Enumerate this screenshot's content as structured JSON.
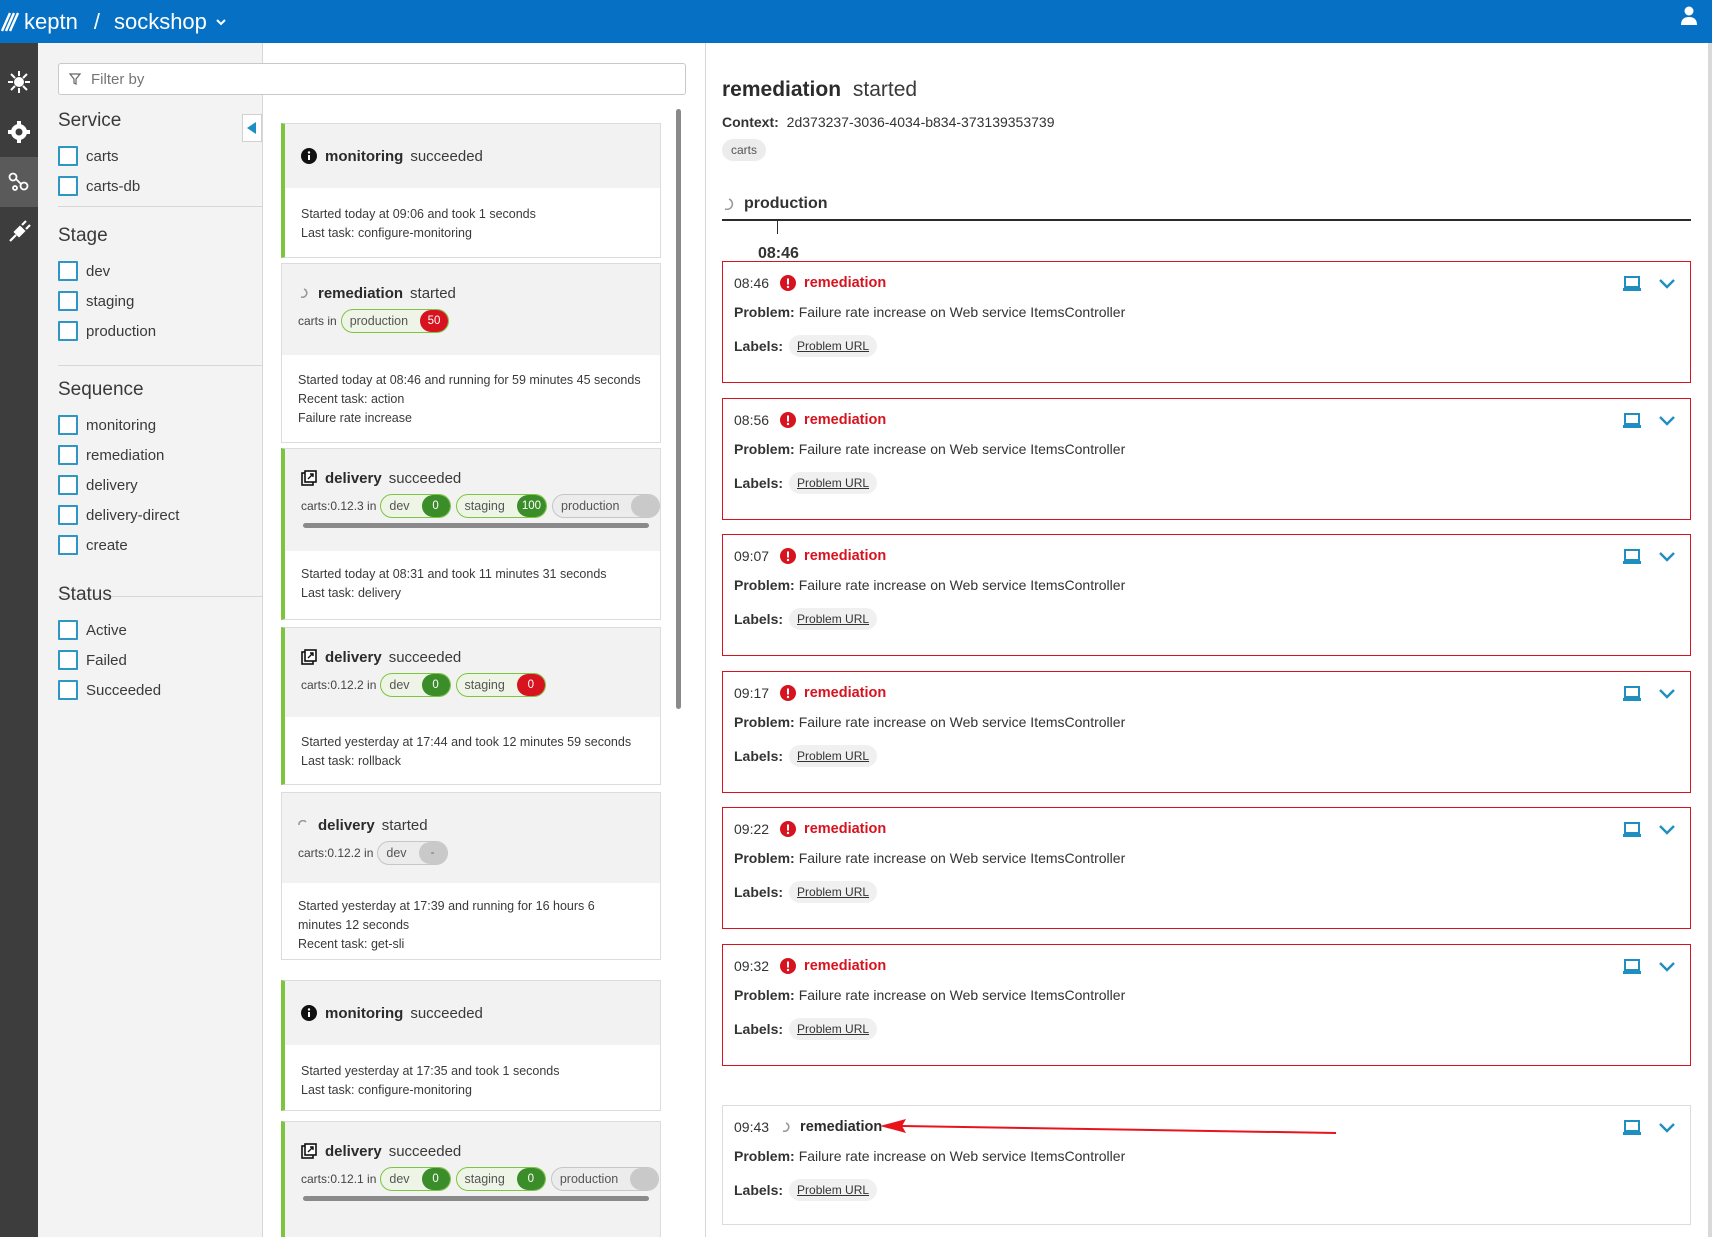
{
  "topbar": {
    "brand": "keptn",
    "separator": "/",
    "project": "sockshop"
  },
  "rail": {
    "items": [
      "environment-icon",
      "settings-icon",
      "sequences-icon",
      "integrations-icon"
    ]
  },
  "filter": {
    "placeholder": "Filter by",
    "groups": {
      "service": {
        "title": "Service",
        "options": [
          "carts",
          "carts-db"
        ]
      },
      "stage": {
        "title": "Stage",
        "options": [
          "dev",
          "staging",
          "production"
        ]
      },
      "sequence": {
        "title": "Sequence",
        "options": [
          "monitoring",
          "remediation",
          "delivery",
          "delivery-direct",
          "create"
        ]
      },
      "status": {
        "title": "Status",
        "options": [
          "Active",
          "Failed",
          "Succeeded"
        ]
      }
    }
  },
  "sequences": [
    {
      "name": "monitoring",
      "state": "succeeded",
      "icon": "info-icon",
      "line1": "Started today at 09:06 and took 1 seconds",
      "line2": "Last task: configure-monitoring"
    },
    {
      "name": "remediation",
      "state": "started",
      "icon": "spinner-icon",
      "service": "carts in",
      "stages": [
        {
          "name": "production",
          "count": "50"
        }
      ],
      "line1": "Started today at 08:46 and running for 59 minutes 45 seconds",
      "line2": "Recent task: action",
      "line3": "Failure rate increase"
    },
    {
      "name": "delivery",
      "state": "succeeded",
      "icon": "delivery-icon",
      "service": "carts:0.12.3 in",
      "stages": [
        {
          "name": "dev",
          "count": "0"
        },
        {
          "name": "staging",
          "count": "100"
        },
        {
          "name": "production",
          "count": ""
        }
      ],
      "line1": "Started today at 08:31 and took 11 minutes 31 seconds",
      "line2": "Last task: delivery"
    },
    {
      "name": "delivery",
      "state": "succeeded",
      "icon": "delivery-icon",
      "service": "carts:0.12.2 in",
      "stages": [
        {
          "name": "dev",
          "count": "0"
        },
        {
          "name": "staging",
          "count": "0"
        }
      ],
      "line1": "Started yesterday at 17:44 and took 12 minutes 59 seconds",
      "line2": "Last task: rollback"
    },
    {
      "name": "delivery",
      "state": "started",
      "icon": "spinner-icon",
      "service": "carts:0.12.2 in",
      "stages": [
        {
          "name": "dev",
          "count": "-"
        }
      ],
      "line1": "Started yesterday at 17:39 and running for 16 hours 6",
      "line2": "minutes 12 seconds",
      "line3": "Recent task: get-sli"
    },
    {
      "name": "monitoring",
      "state": "succeeded",
      "icon": "info-icon",
      "line1": "Started yesterday at 17:35 and took 1 seconds",
      "line2": "Last task: configure-monitoring"
    },
    {
      "name": "delivery",
      "state": "succeeded",
      "icon": "delivery-icon",
      "service": "carts:0.12.1 in",
      "stages": [
        {
          "name": "dev",
          "count": "0"
        },
        {
          "name": "staging",
          "count": "0"
        },
        {
          "name": "production",
          "count": ""
        }
      ]
    }
  ],
  "detail": {
    "title_name": "remediation",
    "title_state": "started",
    "context_label": "Context:",
    "context_id": "2d373237-3036-4034-b834-373139353739",
    "service_tag": "carts",
    "stage": "production",
    "stage_time": "08:46",
    "problem_label": "Problem:",
    "labels_label": "Labels:",
    "events": [
      {
        "time": "08:46",
        "name": "remediation",
        "problem": "Failure rate increase on Web service ItemsController",
        "label": "Problem URL"
      },
      {
        "time": "08:56",
        "name": "remediation",
        "problem": "Failure rate increase on Web service ItemsController",
        "label": "Problem URL"
      },
      {
        "time": "09:07",
        "name": "remediation",
        "problem": "Failure rate increase on Web service ItemsController",
        "label": "Problem URL"
      },
      {
        "time": "09:17",
        "name": "remediation",
        "problem": "Failure rate increase on Web service ItemsController",
        "label": "Problem URL"
      },
      {
        "time": "09:22",
        "name": "remediation",
        "problem": "Failure rate increase on Web service ItemsController",
        "label": "Problem URL"
      },
      {
        "time": "09:32",
        "name": "remediation",
        "problem": "Failure rate increase on Web service ItemsController",
        "label": "Problem URL"
      },
      {
        "time": "09:43",
        "name": "remediation",
        "problem": "Failure rate increase on Web service ItemsController",
        "label": "Problem URL"
      }
    ]
  },
  "colors": {
    "brand": "#0670c4",
    "success": "#7dc540",
    "success_dark": "#3b8d2a",
    "error": "#d6131f",
    "accent": "#2d96c5",
    "annotation_arrow": "#e8141c"
  }
}
